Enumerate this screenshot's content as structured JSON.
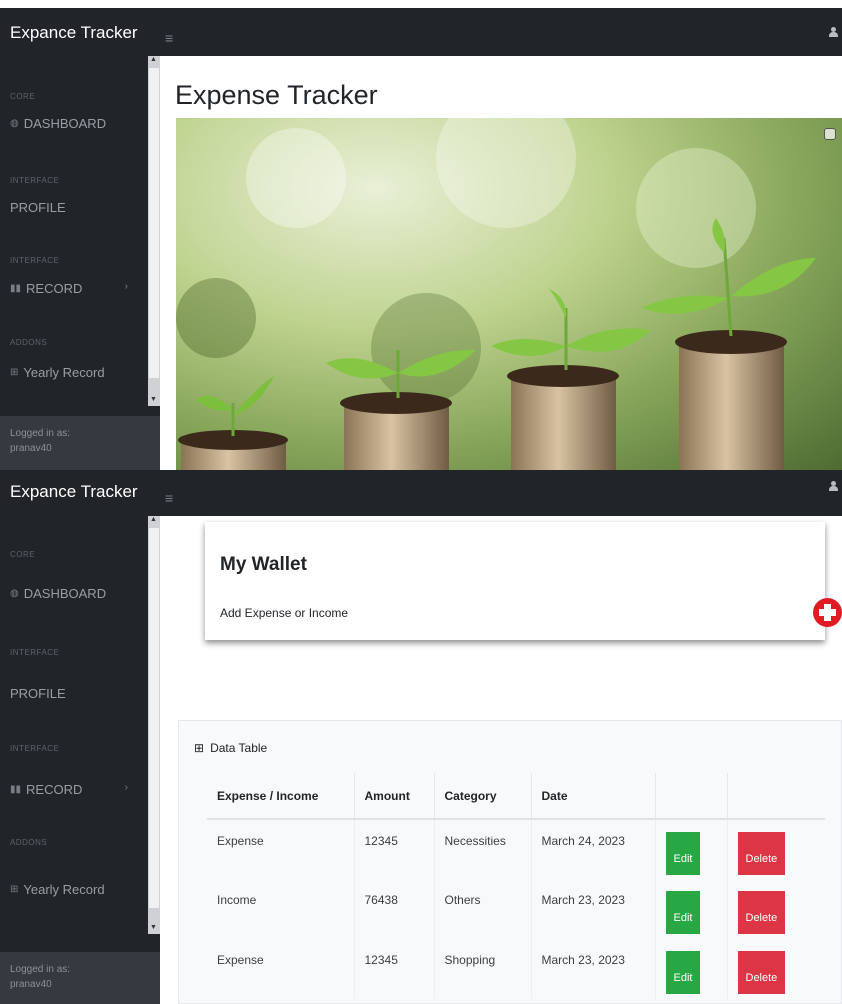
{
  "app": {
    "brand": "Expance Tracker",
    "hamburger": "≡"
  },
  "sidebar": {
    "headings": [
      "CORE",
      "INTERFACE",
      "INTERFACE",
      "ADDONS"
    ],
    "items": [
      {
        "label": "DASHBOARD",
        "icon": "dashboard-icon"
      },
      {
        "label": "PROFILE"
      },
      {
        "label": "RECORD",
        "icon": "columns-icon",
        "chevron": "›"
      },
      {
        "label": "Yearly Record",
        "icon": "table-icon"
      }
    ],
    "footer_label": "Logged in as:",
    "footer_user": "pranav40"
  },
  "main": {
    "title": "Expense Tracker"
  },
  "wallet": {
    "title": "My Wallet",
    "subtitle": "Add Expense or Income"
  },
  "data_table": {
    "title": "Data Table",
    "columns": [
      "Expense / Income",
      "Amount",
      "Category",
      "Date",
      "",
      ""
    ],
    "rows": [
      {
        "type": "Expense",
        "amount": "12345",
        "category": "Necessities",
        "date": "March 24, 2023"
      },
      {
        "type": "Income",
        "amount": "76438",
        "category": "Others",
        "date": "March 23, 2023"
      },
      {
        "type": "Expense",
        "amount": "12345",
        "category": "Shopping",
        "date": "March 23, 2023"
      }
    ],
    "edit_label": "Edit",
    "delete_label": "Delete"
  },
  "colors": {
    "nav_bg": "#212529",
    "edit": "#28a745",
    "delete": "#dc3545",
    "add": "#e01b24"
  }
}
